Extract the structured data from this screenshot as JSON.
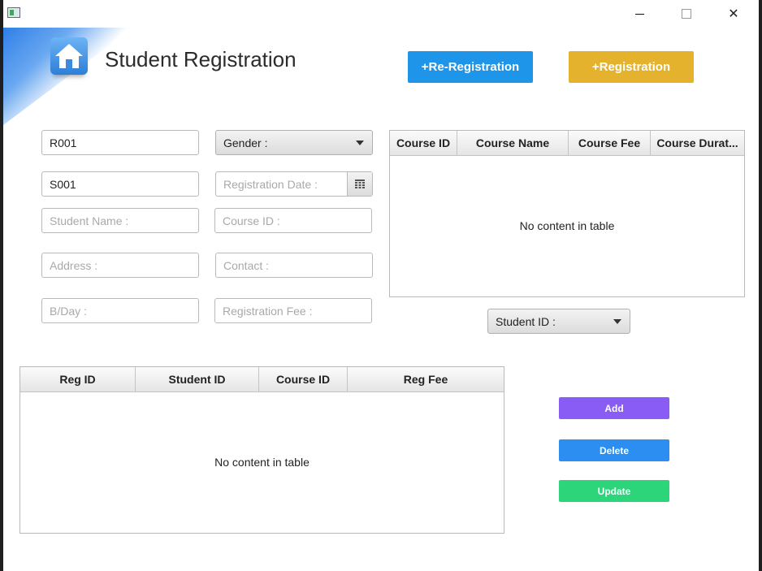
{
  "window": {
    "minimize_icon": "minimize-icon",
    "maximize_icon": "maximize-icon",
    "close_symbol": "✕"
  },
  "header": {
    "title": "Student Registration",
    "icon": "home-icon",
    "re_registration_label": "+Re-Registration",
    "registration_label": "+Registration"
  },
  "form": {
    "registration_id": "R001",
    "student_id": "S001",
    "student_name_placeholder": "Student Name :",
    "address_placeholder": "Address :",
    "birthday_placeholder": "B/Day :",
    "gender_label": "Gender :",
    "registration_date_placeholder": "Registration Date :",
    "course_id_placeholder": "Course ID :",
    "contact_placeholder": "Contact :",
    "registration_fee_placeholder": "Registration Fee :",
    "student_id_combo": "Student ID :"
  },
  "course_table": {
    "columns": [
      "Course ID",
      "Course Name",
      "Course Fee",
      "Course Durat..."
    ],
    "empty_text": "No content in table"
  },
  "registration_table": {
    "columns": [
      "Reg ID",
      "Student ID",
      "Course ID",
      "Reg Fee"
    ],
    "empty_text": "No content in table"
  },
  "actions": {
    "add": "Add",
    "delete": "Delete",
    "update": "Update"
  },
  "colors": {
    "re_registration": "#1e95e8",
    "registration": "#e4b22c",
    "add": "#8a5cf6",
    "delete": "#2b8ef0",
    "update": "#2cd47a"
  }
}
